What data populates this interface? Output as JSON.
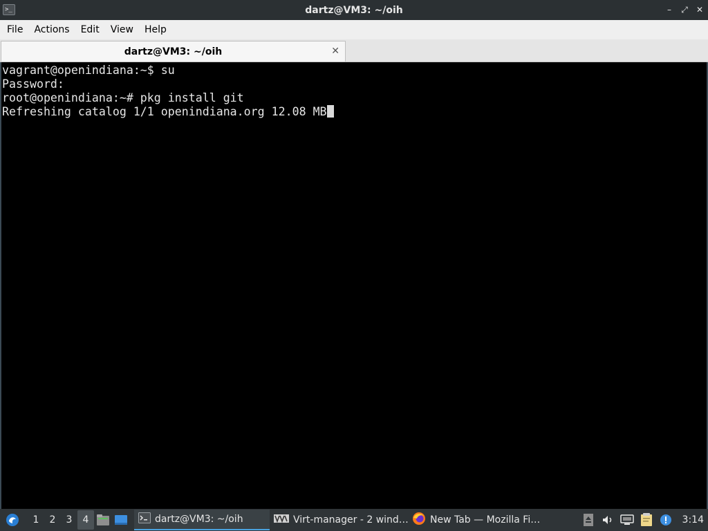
{
  "window": {
    "title": "dartz@VM3: ~/oih",
    "app_icon_glyph": ">_",
    "controls": {
      "minimize": "–",
      "maximize": "⤢",
      "close": "✕"
    }
  },
  "menubar": {
    "items": [
      {
        "label": "File"
      },
      {
        "label": "Actions"
      },
      {
        "label": "Edit"
      },
      {
        "label": "View"
      },
      {
        "label": "Help"
      }
    ]
  },
  "tabs": [
    {
      "label": "dartz@VM3: ~/oih",
      "close_glyph": "✕"
    }
  ],
  "terminal": {
    "lines": [
      "vagrant@openindiana:~$ su",
      "Password:",
      "root@openindiana:~# pkg install git",
      "Refreshing catalog 1/1 openindiana.org 12.08 MB"
    ]
  },
  "taskbar": {
    "start_icon": "start-menu-icon",
    "desktops": [
      "1",
      "2",
      "3",
      "4"
    ],
    "active_desktop": "4",
    "quicklaunch": [
      {
        "icon": "file-manager-icon"
      },
      {
        "icon": "show-desktop-icon"
      }
    ],
    "tasks": [
      {
        "label": "dartz@VM3: ~/oih",
        "icon": "terminal-icon",
        "active": true
      },
      {
        "label": "Virt-manager - 2 wind…",
        "icon": "virt-manager-icon",
        "active": false
      },
      {
        "label": "New Tab — Mozilla Fi…",
        "icon": "firefox-icon",
        "active": false
      }
    ],
    "tray": [
      {
        "icon": "eject-icon"
      },
      {
        "icon": "volume-icon"
      },
      {
        "icon": "network-icon"
      },
      {
        "icon": "clipboard-icon"
      },
      {
        "icon": "notification-icon"
      }
    ],
    "clock": "3:14"
  },
  "colors": {
    "terminal_bg": "#000000",
    "terminal_fg": "#e6e6e6",
    "titlebar_bg": "#2b3033",
    "taskbar_bg": "#2f3437",
    "accent": "#4aa3e0"
  }
}
